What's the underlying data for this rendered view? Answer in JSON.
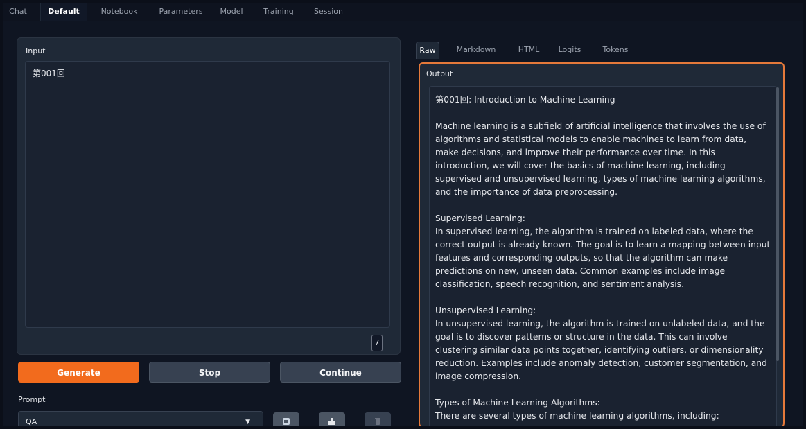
{
  "top_tabs": [
    "Chat",
    "Default",
    "Notebook",
    "Parameters",
    "Model",
    "Training",
    "Session"
  ],
  "active_top_tab": "Default",
  "input": {
    "label": "Input",
    "value": "第001回",
    "token_count": "7"
  },
  "buttons": {
    "generate": "Generate",
    "stop": "Stop",
    "continue": "Continue"
  },
  "prompt": {
    "label": "Prompt",
    "selected": "QA"
  },
  "output_tabs": [
    "Raw",
    "Markdown",
    "HTML",
    "Logits",
    "Tokens"
  ],
  "active_output_tab": "Raw",
  "output": {
    "label": "Output",
    "paragraphs": [
      "第001回: Introduction to Machine Learning",
      "Machine learning is a subfield of artificial intelligence that involves the use of algorithms and statistical models to enable machines to learn from data, make decisions, and improve their performance over time. In this introduction, we will cover the basics of machine learning, including supervised and unsupervised learning, types of machine learning algorithms, and the importance of data preprocessing.",
      "Supervised Learning:\nIn supervised learning, the algorithm is trained on labeled data, where the correct output is already known. The goal is to learn a mapping between input features and corresponding outputs, so that the algorithm can make predictions on new, unseen data. Common examples include image classification, speech recognition, and sentiment analysis.",
      "Unsupervised Learning:\nIn unsupervised learning, the algorithm is trained on unlabeled data, and the goal is to discover patterns or structure in the data. This can involve clustering similar data points together, identifying outliers, or dimensionality reduction. Examples include anomaly detection, customer segmentation, and image compression.",
      "Types of Machine Learning Algorithms:\nThere are several types of machine learning algorithms, including:"
    ]
  },
  "colors": {
    "accent": "#f26b1d",
    "output_border": "#e5793a",
    "background": "#0f1522",
    "panel": "#1f2937"
  }
}
